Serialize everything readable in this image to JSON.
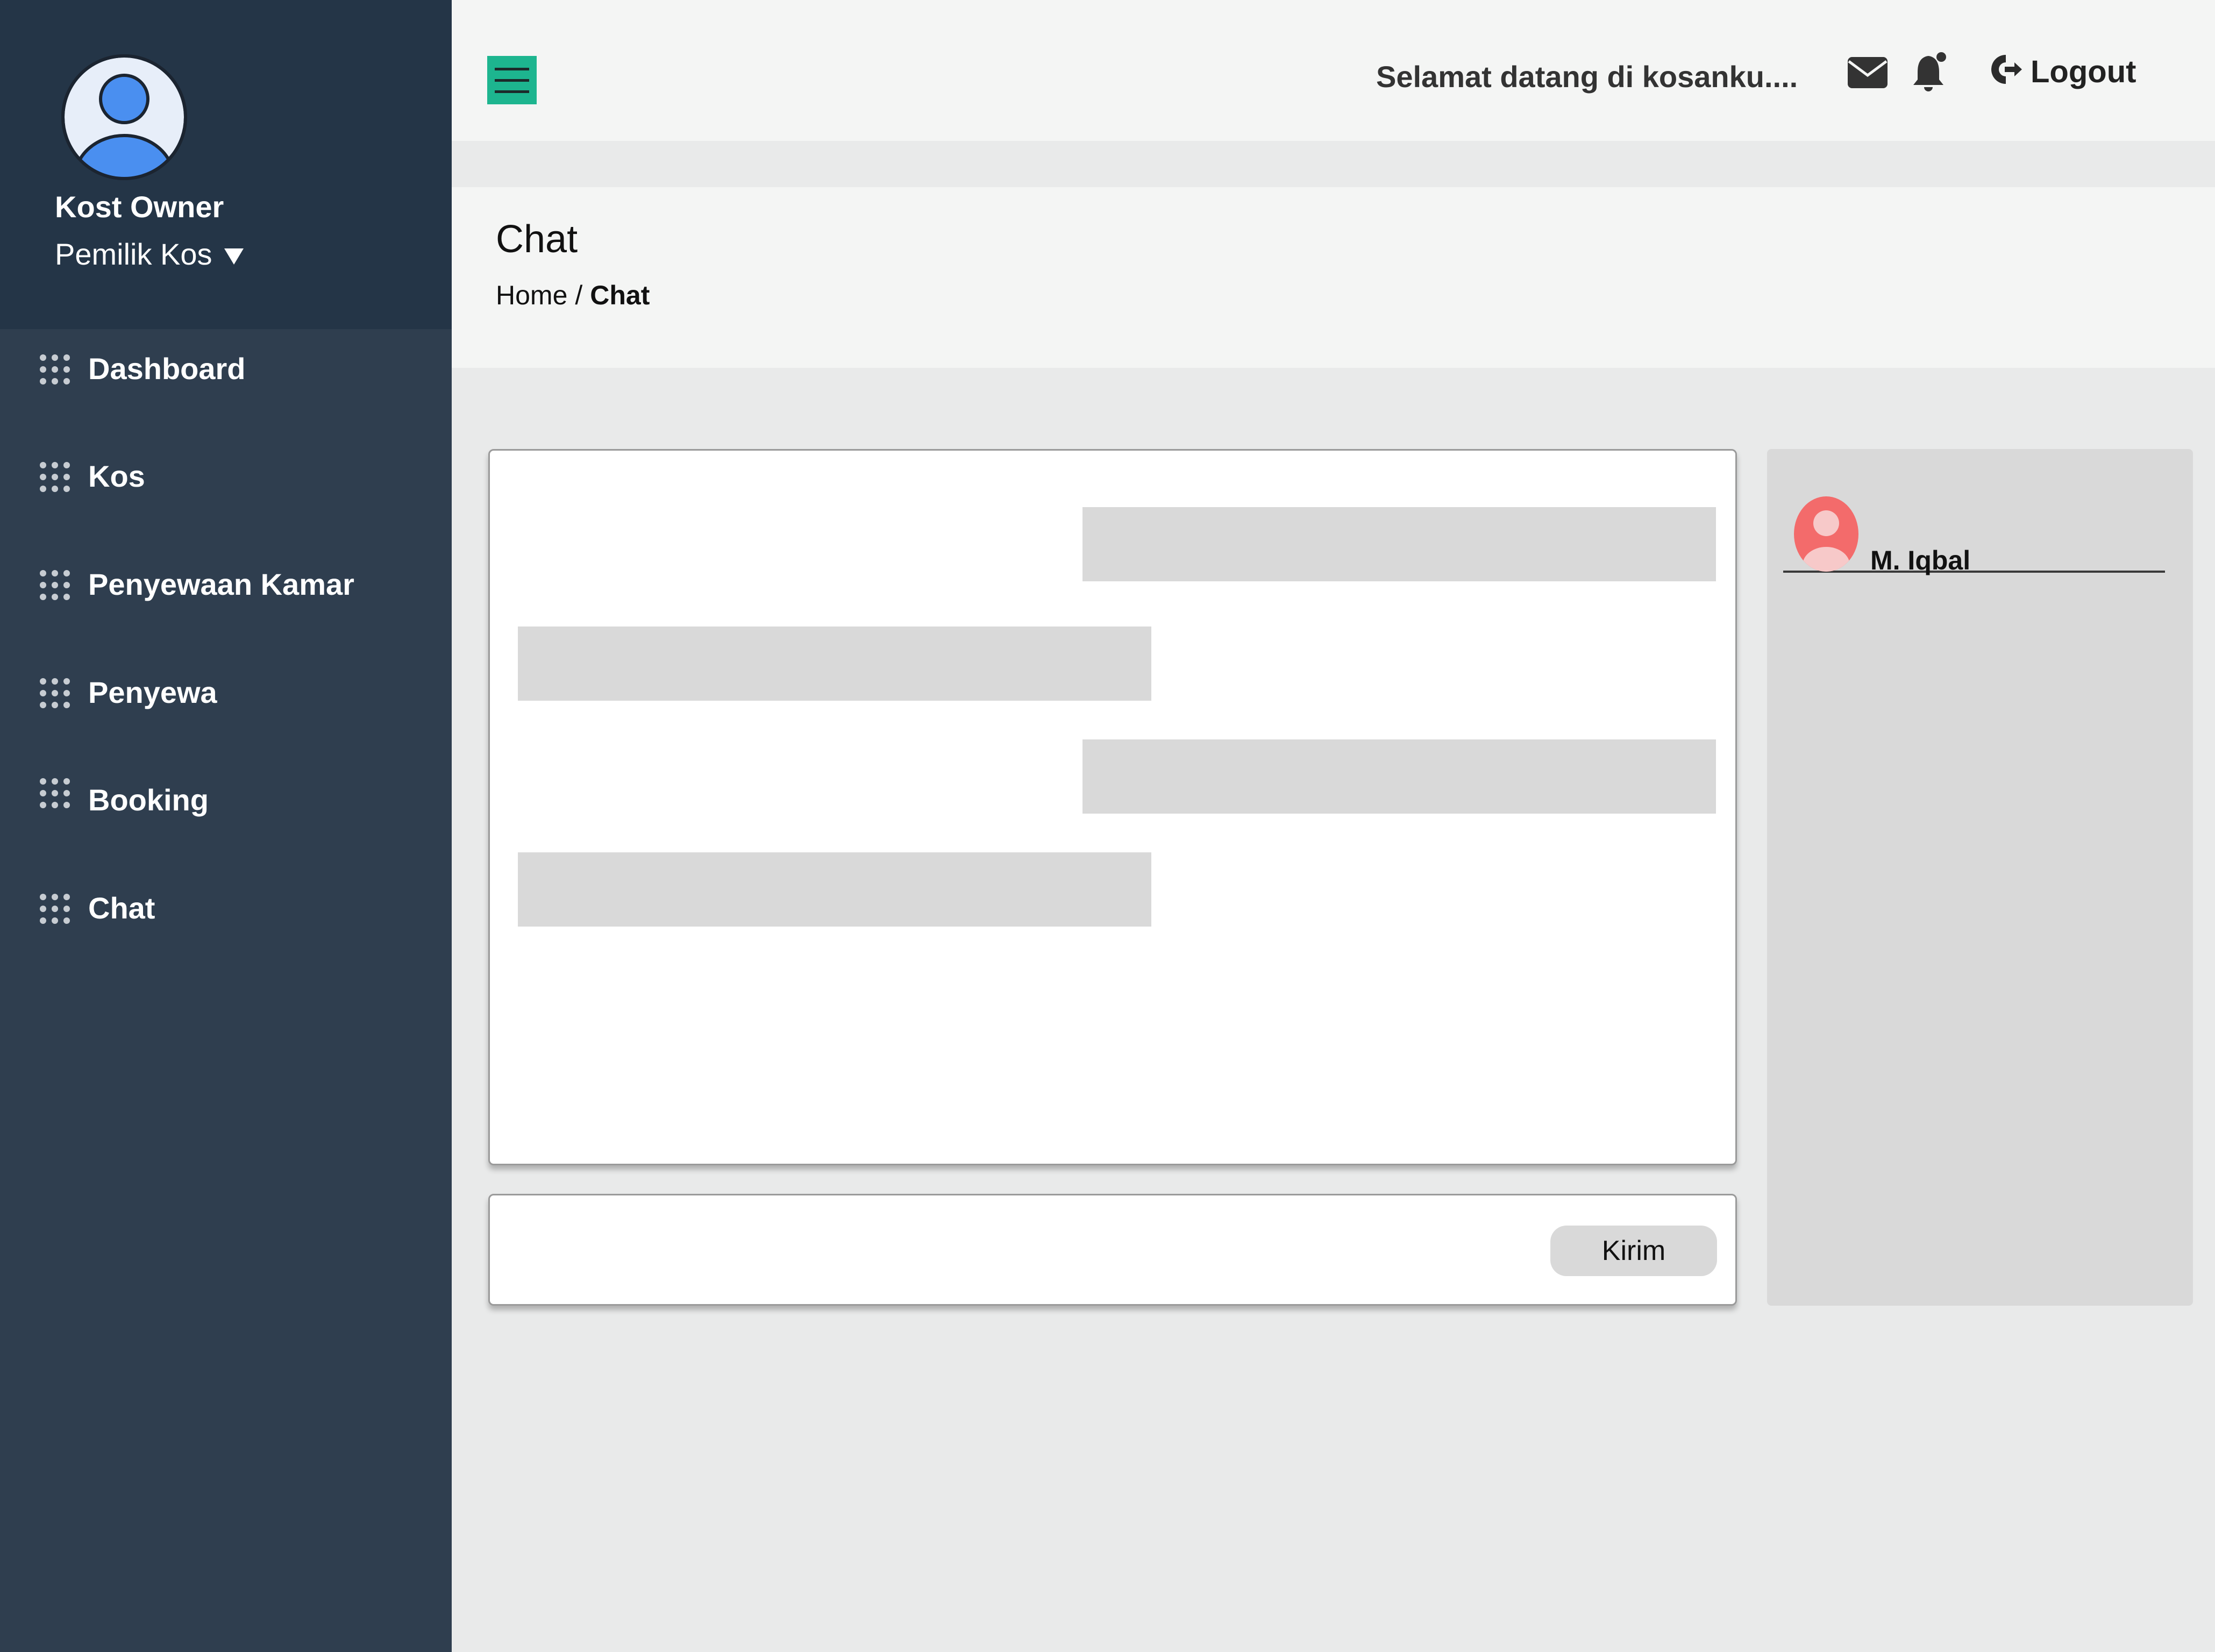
{
  "sidebar": {
    "profile": {
      "name": "Kost Owner",
      "role": "Pemilik Kos"
    },
    "items": [
      {
        "label": "Dashboard",
        "icon": "grid-dots-icon"
      },
      {
        "label": "Kos",
        "icon": "grid-dots-icon"
      },
      {
        "label": "Penyewaan Kamar",
        "icon": "grid-dots-icon"
      },
      {
        "label": "Penyewa",
        "icon": "grid-dots-icon"
      },
      {
        "label": "Booking",
        "icon": "grid-dots-icon"
      },
      {
        "label": "Chat",
        "icon": "grid-dots-icon"
      }
    ]
  },
  "header": {
    "welcome": "Selamat datang di kosanku....",
    "logout_label": "Logout",
    "icons": [
      "menu-icon",
      "mail-icon",
      "bell-icon",
      "logout-icon"
    ]
  },
  "page": {
    "title": "Chat",
    "breadcrumb": {
      "home": "Home",
      "separator": "/",
      "current": "Chat"
    }
  },
  "chat": {
    "send_label": "Kirim",
    "input_value": "",
    "messages": [
      {
        "side": "right",
        "text": ""
      },
      {
        "side": "left",
        "text": ""
      },
      {
        "side": "right",
        "text": ""
      },
      {
        "side": "left",
        "text": ""
      }
    ]
  },
  "contacts": [
    {
      "name": "M. Iqbal",
      "icon": "user-avatar-icon"
    }
  ],
  "colors": {
    "sidebar": "#2f3e4f",
    "sidebar_profile": "#243547",
    "accent": "#1db58f",
    "avatar_blue": "#4a8ff0",
    "contact_avatar": "#f36b6b",
    "bubble": "#d9d9d9"
  }
}
